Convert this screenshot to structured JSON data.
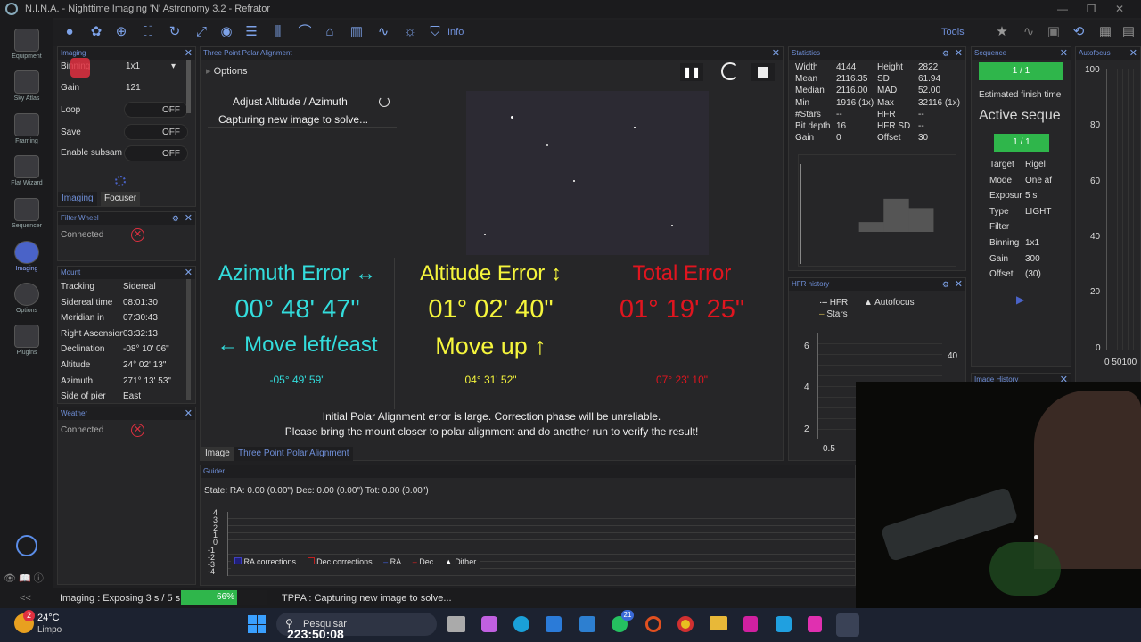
{
  "title": "N.I.N.A. - Nighttime Imaging 'N' Astronomy 3.2  -  Refrator",
  "sidebar": [
    {
      "label": "Equipment",
      "active": false
    },
    {
      "label": "Sky Atlas",
      "active": false
    },
    {
      "label": "Framing",
      "active": false
    },
    {
      "label": "Flat Wizard",
      "active": false
    },
    {
      "label": "Sequencer",
      "active": false
    },
    {
      "label": "Imaging",
      "active": true
    },
    {
      "label": "Options",
      "active": false
    },
    {
      "label": "Plugins",
      "active": false
    }
  ],
  "toolbar": {
    "info": "Info",
    "tools": "Tools"
  },
  "imaging": {
    "header": "Imaging",
    "binning_label": "Binning",
    "binning": "1x1",
    "gain_label": "Gain",
    "gain": "121",
    "loop_label": "Loop",
    "loop": "OFF",
    "save_label": "Save",
    "save": "OFF",
    "subsam_label": "Enable subsam",
    "subsam": "OFF",
    "tab1": "Imaging",
    "tab2": "Focuser"
  },
  "filterwheel": {
    "header": "Filter Wheel",
    "status": "Connected"
  },
  "mount": {
    "header": "Mount",
    "rows": [
      [
        "Tracking",
        "Sidereal"
      ],
      [
        "Sidereal time",
        "08:01:30"
      ],
      [
        "Meridian in",
        "07:30:43"
      ],
      [
        "Right Ascension",
        "03:32:13"
      ],
      [
        "Declination",
        "-08° 10' 06\""
      ],
      [
        "Altitude",
        "24° 02' 13\""
      ],
      [
        "Azimuth",
        "271° 13' 53\""
      ],
      [
        "Side of pier",
        "East"
      ]
    ]
  },
  "weather": {
    "header": "Weather",
    "status": "Connected"
  },
  "tppa": {
    "header": "Three Point Polar Alignment",
    "options": "Options",
    "step": "Adjust Altitude / Azimuth",
    "status": "Capturing new image to solve...",
    "az_title": "Azimuth Error ↔",
    "az_value": "00° 48' 47\"",
    "az_move": "← Move left/east",
    "az_sub": "-05° 49' 59\"",
    "alt_title": "Altitude Error ↕",
    "alt_value": "01° 02' 40\"",
    "alt_move": "Move up ↑",
    "alt_sub": "04° 31' 52\"",
    "tot_title": "Total Error",
    "tot_value": "01° 19' 25\"",
    "tot_sub": "07° 23' 10\"",
    "warn1": "Initial Polar Alignment error is large. Correction phase will be unreliable.",
    "warn2": "Please bring the mount closer to polar alignment and do another run to verify the result!",
    "tab_image": "Image",
    "tab_tppa": "Three Point Polar Alignment"
  },
  "stats": {
    "header": "Statistics",
    "rows": [
      [
        "Width",
        "4144",
        "Height",
        "2822"
      ],
      [
        "Mean",
        "2116.35",
        "SD",
        "61.94"
      ],
      [
        "Median",
        "2116.00",
        "MAD",
        "52.00"
      ],
      [
        "Min",
        "1916 (1x)",
        "Max",
        "32116 (1x)"
      ],
      [
        "#Stars",
        "--",
        "HFR",
        "--"
      ],
      [
        "Bit depth",
        "16",
        "HFR SD",
        "--"
      ],
      [
        "Gain",
        "0",
        "Offset",
        "30"
      ]
    ]
  },
  "hfr": {
    "header": "HFR history",
    "legend_hfr": "HFR",
    "legend_af": "Autofocus",
    "legend_stars": "Stars",
    "y_ticks": [
      "6",
      "4",
      "2"
    ],
    "x_tick": "0.5",
    "y2_tick": "40"
  },
  "sequence": {
    "header": "Sequence",
    "progress": "1 / 1",
    "finish": "Estimated finish time",
    "active": "Active seque",
    "progress2": "1 / 1",
    "rows": [
      [
        "Target",
        "Rigel"
      ],
      [
        "Mode",
        "One af"
      ],
      [
        "Exposur",
        "5 s"
      ],
      [
        "Type",
        "LIGHT"
      ],
      [
        "Filter",
        ""
      ],
      [
        "Binning",
        "1x1"
      ],
      [
        "Gain",
        "300"
      ],
      [
        "Offset",
        "(30)"
      ]
    ]
  },
  "image_history": {
    "header": "Image History"
  },
  "autofocus": {
    "header": "Autofocus",
    "y_ticks": [
      "100",
      "80",
      "60",
      "40",
      "20",
      "0"
    ],
    "x_ticks": "0 50100"
  },
  "guider": {
    "header": "Guider",
    "state": "State:  RA: 0.00 (0.00\")  Dec: 0.00 (0.00\")  Tot: 0.00 (0.00\")",
    "y_ticks": [
      "4",
      "3",
      "2",
      "1",
      "0",
      "-1",
      "-2",
      "-3",
      "-4"
    ],
    "legend": [
      "RA corrections",
      "Dec corrections",
      "RA",
      "Dec",
      "Dither"
    ]
  },
  "statusbar": {
    "imaging": "Imaging :  Exposing 3 s / 5 s",
    "progress": "66%",
    "progress_value": 0.66,
    "tppa": "TPPA :  Capturing new image to solve..."
  },
  "taskbar": {
    "temp": "24°C",
    "weather": "Limpo",
    "badge": "2",
    "search": "Pesquisar",
    "clock": "223:50:08",
    "wa_badge": "21"
  }
}
